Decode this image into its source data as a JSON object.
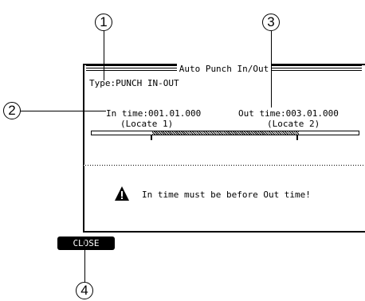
{
  "callouts": [
    "1",
    "2",
    "3",
    "4"
  ],
  "dialog": {
    "title": "Auto Punch In/Out",
    "type_label": "Type:",
    "type_value": "PUNCH IN-OUT",
    "in_label": "In time:",
    "in_value": "001.01.000",
    "in_locate": "(Locate 1)",
    "out_label": "Out time:",
    "out_value": "003.01.000",
    "out_locate": "(Locate 2)",
    "warning_icon": "warning-triangle-icon",
    "warning_text": "In time must be before Out time!"
  },
  "footer": {
    "close_label": "CLOSE"
  }
}
